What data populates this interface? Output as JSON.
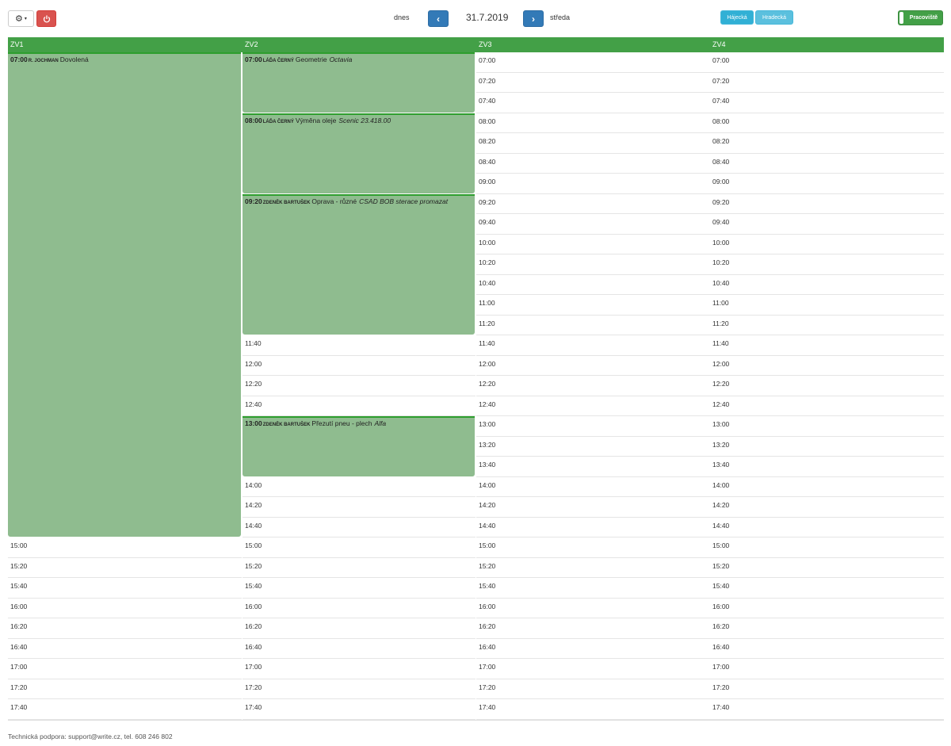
{
  "toolbar": {
    "gear_icon": "⚙",
    "caret_icon": "▾",
    "power_icon": "⏻",
    "today_label": "dnes",
    "prev_icon": "‹",
    "next_icon": "›",
    "date": "31.7.2019",
    "weekday": "středa",
    "locations": [
      "Hájecká",
      "Hradecká"
    ],
    "toggle_label": "Pracoviště"
  },
  "colors": {
    "header": "#43a047",
    "event": "#8fbc8f",
    "event_border": "#2e9e2e",
    "danger": "#d9534f",
    "primary": "#337ab7",
    "info": "#5bc0de"
  },
  "columns": [
    "ZV1",
    "ZV2",
    "ZV3",
    "ZV4"
  ],
  "times": [
    "07:00",
    "07:20",
    "07:40",
    "08:00",
    "08:20",
    "08:40",
    "09:00",
    "09:20",
    "09:40",
    "10:00",
    "10:20",
    "10:40",
    "11:00",
    "11:20",
    "11:40",
    "12:00",
    "12:20",
    "12:40",
    "13:00",
    "13:20",
    "13:40",
    "14:00",
    "14:20",
    "14:40",
    "15:00",
    "15:20",
    "15:40",
    "16:00",
    "16:20",
    "16:40",
    "17:00",
    "17:20",
    "17:40"
  ],
  "events": [
    {
      "column": 0,
      "start": "07:00",
      "end": "15:00",
      "time": "07:00",
      "who": "R. Jochman",
      "what": "Dovolená",
      "note": ""
    },
    {
      "column": 1,
      "start": "07:00",
      "end": "08:00",
      "time": "07:00",
      "who": "Láďa Černý",
      "what": "Geometrie",
      "note": "Octavia"
    },
    {
      "column": 1,
      "start": "08:00",
      "end": "09:20",
      "time": "08:00",
      "who": "Láďa Černý",
      "what": "Výměna oleje",
      "note": "Scenic 23.418.00"
    },
    {
      "column": 1,
      "start": "09:20",
      "end": "11:40",
      "time": "09:20",
      "who": "Zdeněk Bartušek",
      "what": "Oprava - různé",
      "note": "CSAD BOB sterace promazat"
    },
    {
      "column": 1,
      "start": "13:00",
      "end": "14:00",
      "time": "13:00",
      "who": "Zdeněk Bartušek",
      "what": "Přezutí pneu - plech",
      "note": "Alfa"
    }
  ],
  "footer": "Technická podpora: support@write.cz, tel. 608 246 802"
}
